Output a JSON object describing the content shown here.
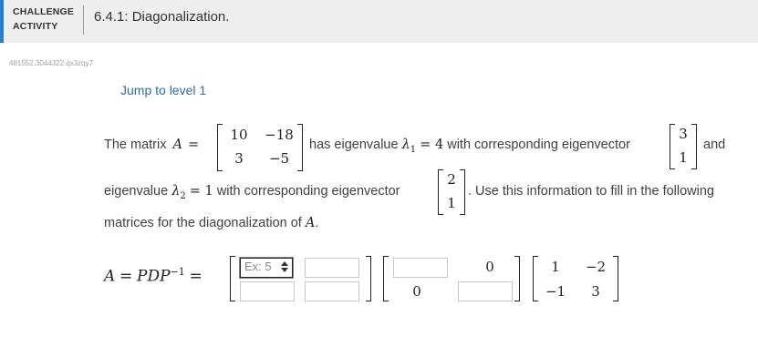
{
  "header": {
    "label_line1": "CHALLENGE",
    "label_line2": "ACTIVITY",
    "title": "6.4.1: Diagonalization."
  },
  "activity_id": "481552.3044322.qx3zqy7",
  "jump_link": "Jump to level 1",
  "problem": {
    "intro": "The matrix",
    "var_A": "A",
    "equals": "=",
    "matrix_A": [
      [
        "10",
        "−18"
      ],
      [
        "3",
        "−5"
      ]
    ],
    "has_eigenvalue": "has eigenvalue",
    "lambda1": "λ",
    "lambda1_sub": "1",
    "eq_value1": "= 4",
    "with_eigvec": "with corresponding eigenvector",
    "eigvec1": [
      "3",
      "1"
    ],
    "and": "and",
    "eigenvalue_word": "eigenvalue",
    "lambda2": "λ",
    "lambda2_sub": "2",
    "eq_value2": "= 1",
    "with_eigvec2": "with corresponding eigenvector",
    "eigvec2": [
      "2",
      "1"
    ],
    "use_info": ". Use this information to fill in the following",
    "line3_text": "matrices for the diagonalization of",
    "line3_var": "A",
    "line3_end": "."
  },
  "equation": {
    "lhs_A": "A",
    "lhs_eq": "=",
    "lhs_PDP": "PDP",
    "lhs_sup": "−1",
    "rhs_eq": "=",
    "P_placeholder": "Ex: 5",
    "D_entries": {
      "top_right": "0",
      "bottom_left": "0"
    },
    "Pinv": [
      [
        "1",
        "−2"
      ],
      [
        "−1",
        "3"
      ]
    ]
  }
}
